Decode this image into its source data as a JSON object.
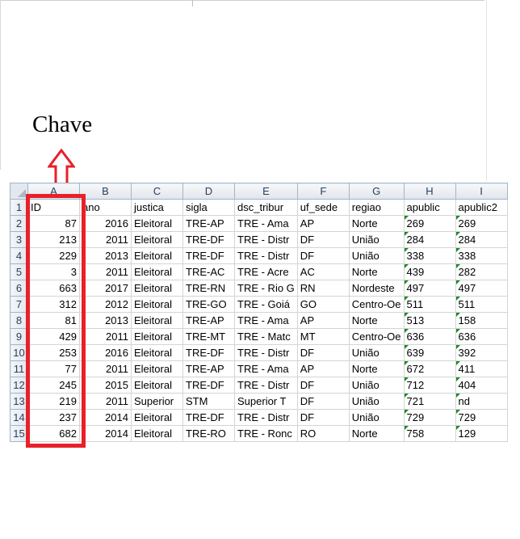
{
  "caption": "Chave",
  "columns": [
    "A",
    "B",
    "C",
    "D",
    "E",
    "F",
    "G",
    "H",
    "I"
  ],
  "header_row": {
    "number": "1",
    "cells": [
      "ID",
      "ano",
      "justica",
      "sigla",
      "dsc_tribur",
      "uf_sede",
      "regiao",
      "apublic",
      "apublic2"
    ]
  },
  "rows": [
    {
      "number": "2",
      "cells": [
        "87",
        "2016",
        "Eleitoral",
        "TRE-AP",
        "TRE - Ama",
        "AP",
        "Norte",
        "269",
        "269"
      ]
    },
    {
      "number": "3",
      "cells": [
        "213",
        "2011",
        "Eleitoral",
        "TRE-DF",
        "TRE - Distr",
        "DF",
        "União",
        "284",
        "284"
      ]
    },
    {
      "number": "4",
      "cells": [
        "229",
        "2013",
        "Eleitoral",
        "TRE-DF",
        "TRE - Distr",
        "DF",
        "União",
        "338",
        "338"
      ]
    },
    {
      "number": "5",
      "cells": [
        "3",
        "2011",
        "Eleitoral",
        "TRE-AC",
        "TRE - Acre",
        "AC",
        "Norte",
        "439",
        "282"
      ]
    },
    {
      "number": "6",
      "cells": [
        "663",
        "2017",
        "Eleitoral",
        "TRE-RN",
        "TRE - Rio G",
        "RN",
        "Nordeste",
        "497",
        "497"
      ]
    },
    {
      "number": "7",
      "cells": [
        "312",
        "2012",
        "Eleitoral",
        "TRE-GO",
        "TRE - Goiá",
        "GO",
        "Centro-Oe",
        "511",
        "511"
      ]
    },
    {
      "number": "8",
      "cells": [
        "81",
        "2013",
        "Eleitoral",
        "TRE-AP",
        "TRE - Ama",
        "AP",
        "Norte",
        "513",
        "158"
      ]
    },
    {
      "number": "9",
      "cells": [
        "429",
        "2011",
        "Eleitoral",
        "TRE-MT",
        "TRE - Matc",
        "MT",
        "Centro-Oe",
        "636",
        "636"
      ]
    },
    {
      "number": "10",
      "cells": [
        "253",
        "2016",
        "Eleitoral",
        "TRE-DF",
        "TRE - Distr",
        "DF",
        "União",
        "639",
        "392"
      ]
    },
    {
      "number": "11",
      "cells": [
        "77",
        "2011",
        "Eleitoral",
        "TRE-AP",
        "TRE - Ama",
        "AP",
        "Norte",
        "672",
        "411"
      ]
    },
    {
      "number": "12",
      "cells": [
        "245",
        "2015",
        "Eleitoral",
        "TRE-DF",
        "TRE - Distr",
        "DF",
        "União",
        "712",
        "404"
      ]
    },
    {
      "number": "13",
      "cells": [
        "219",
        "2011",
        "Superior",
        "STM",
        "Superior T",
        "DF",
        "União",
        "721",
        "nd"
      ]
    },
    {
      "number": "14",
      "cells": [
        "237",
        "2014",
        "Eleitoral",
        "TRE-DF",
        "TRE - Distr",
        "DF",
        "União",
        "729",
        "729"
      ]
    },
    {
      "number": "15",
      "cells": [
        "682",
        "2014",
        "Eleitoral",
        "TRE-RO",
        "TRE - Ronc",
        "RO",
        "Norte",
        "758",
        "129"
      ]
    }
  ],
  "colors": {
    "highlight": "#e8202a",
    "header_text": "#27415f",
    "error_flag": "#1f8a1f"
  }
}
